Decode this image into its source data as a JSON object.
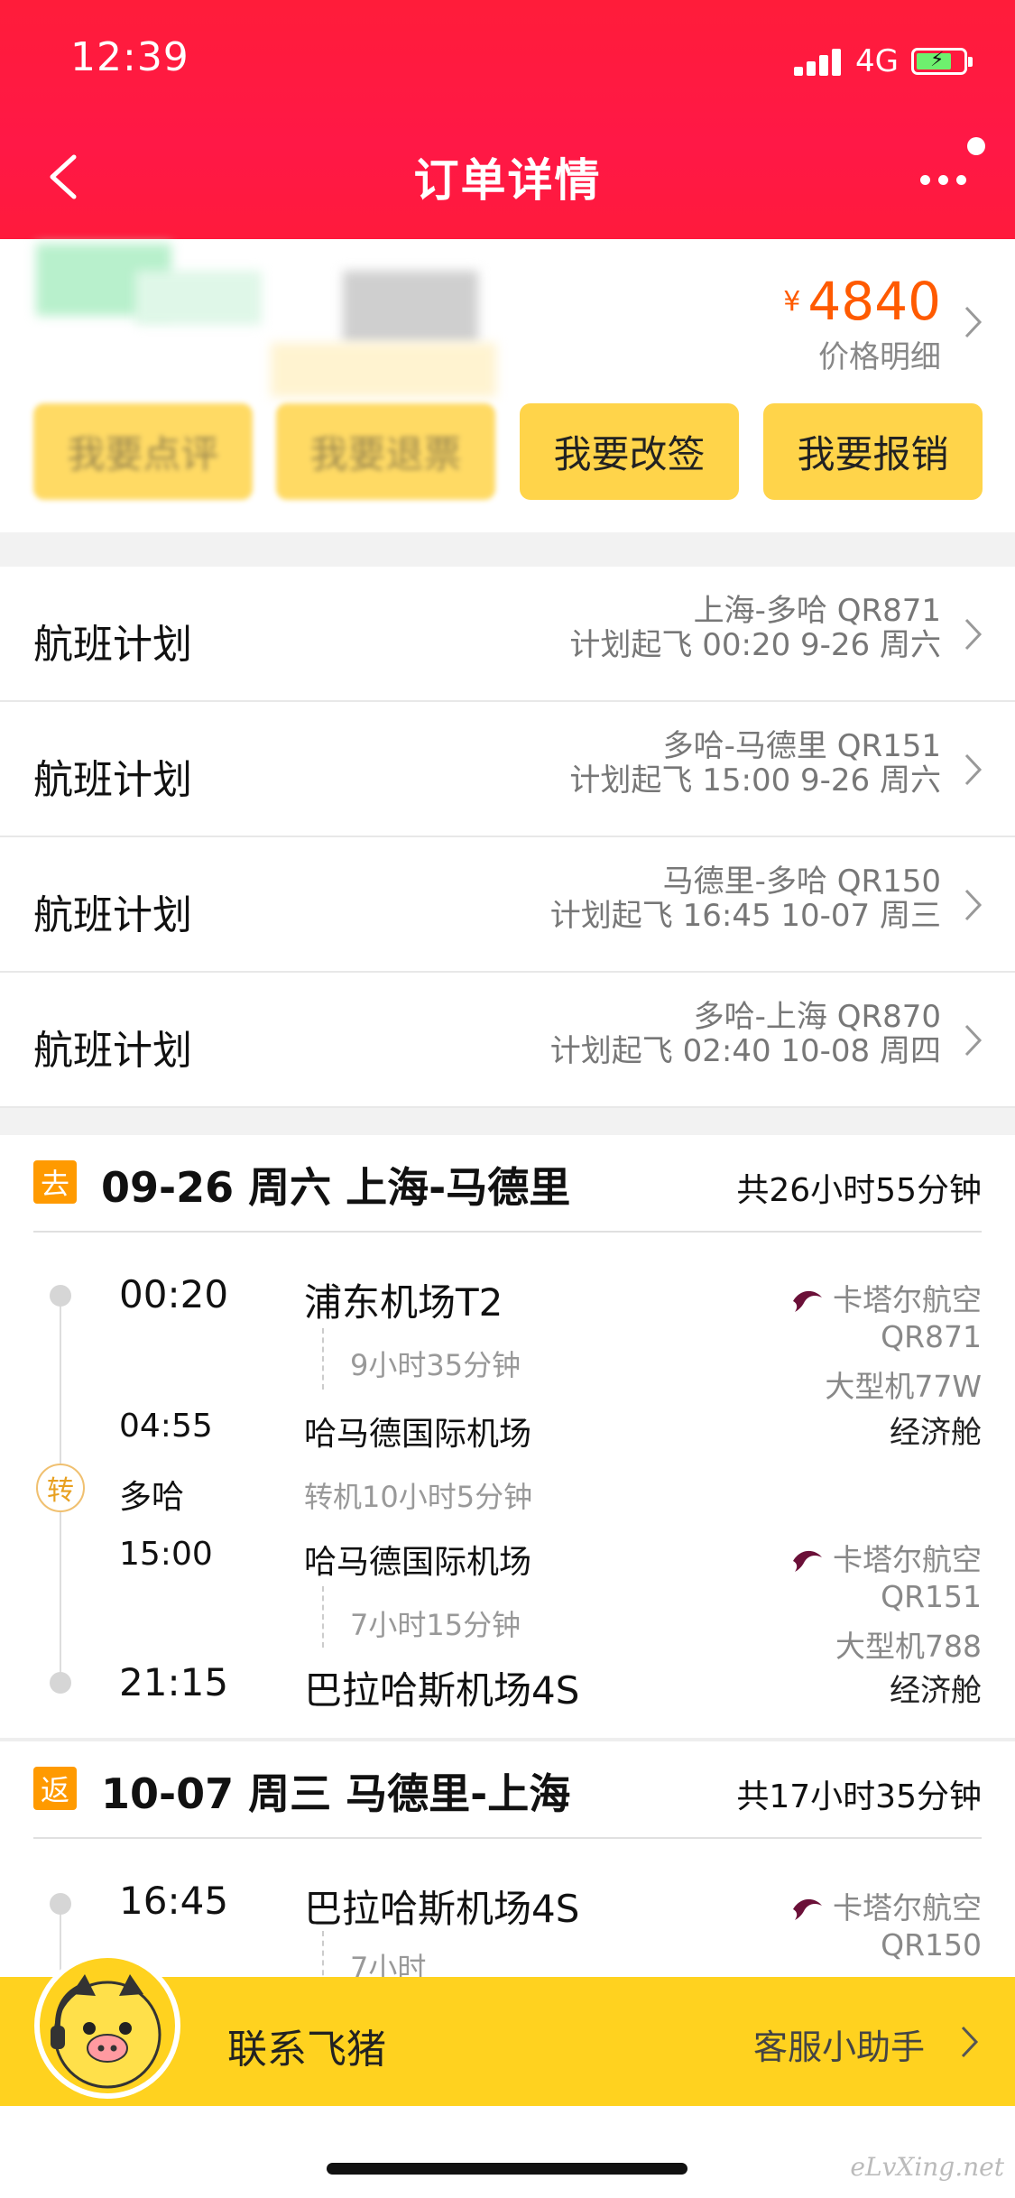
{
  "status_bar": {
    "time": "12:39",
    "network": "4G"
  },
  "header": {
    "title": "订单详情"
  },
  "order": {
    "currency": "¥",
    "price": "4840",
    "price_detail_label": "价格明细",
    "actions": [
      "我要点评",
      "我要退票",
      "我要改签",
      "我要报销"
    ]
  },
  "flight_plans": [
    {
      "label": "航班计划",
      "route": "上海-多哈 QR871",
      "schedule": "计划起飞 00:20 9-26 周六"
    },
    {
      "label": "航班计划",
      "route": "多哈-马德里 QR151",
      "schedule": "计划起飞 15:00 9-26 周六"
    },
    {
      "label": "航班计划",
      "route": "马德里-多哈 QR150",
      "schedule": "计划起飞 16:45 10-07 周三"
    },
    {
      "label": "航班计划",
      "route": "多哈-上海 QR870",
      "schedule": "计划起飞 02:40 10-08 周四"
    }
  ],
  "outbound": {
    "badge": "去",
    "title": "09-26 周六 上海-马德里",
    "total": "共26小时55分钟",
    "seg1": {
      "dep_time": "00:20",
      "dep_airport": "浦东机场T2",
      "duration": "9小时35分钟",
      "arr_time": "04:55",
      "arr_airport": "哈马德国际机场",
      "airline": "卡塔尔航空",
      "flight_no": "QR871",
      "aircraft": "大型机77W",
      "cabin": "经济舱"
    },
    "transfer": {
      "badge": "转",
      "city": "多哈",
      "text": "转机10小时5分钟"
    },
    "seg2": {
      "dep_time": "15:00",
      "dep_airport": "哈马德国际机场",
      "duration": "7小时15分钟",
      "arr_time": "21:15",
      "arr_airport": "巴拉哈斯机场4S",
      "airline": "卡塔尔航空",
      "flight_no": "QR151",
      "aircraft": "大型机788",
      "cabin": "经济舱"
    }
  },
  "return": {
    "badge": "返",
    "title": "10-07 周三 马德里-上海",
    "total": "共17小时35分钟",
    "seg1": {
      "dep_time": "16:45",
      "dep_airport": "巴拉哈斯机场4S",
      "duration": "7小时",
      "airline": "卡塔尔航空",
      "flight_no": "QR150"
    }
  },
  "contact": {
    "label": "联系飞猪",
    "helper": "客服小助手"
  },
  "watermark": "eLvXing.net",
  "colors": {
    "header": "#ff1c3a",
    "price": "#ff5a00",
    "button": "#ffd44a",
    "contact_bar": "#ffd21f",
    "badge": "#ff9a00"
  }
}
